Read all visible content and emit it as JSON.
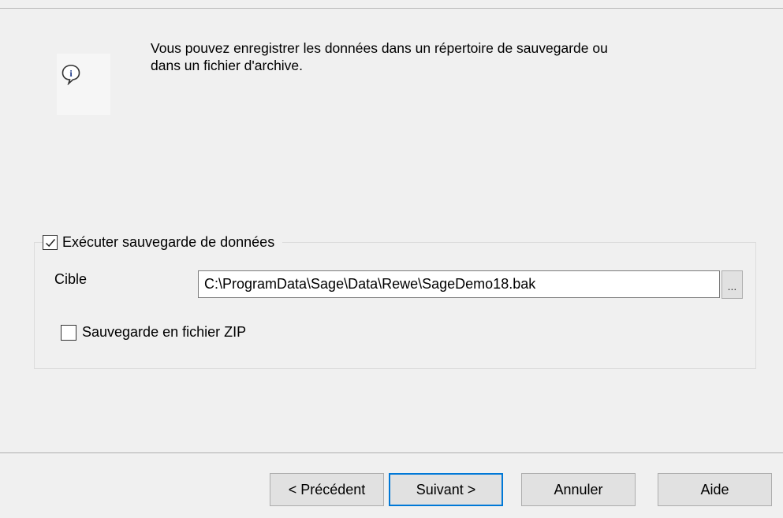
{
  "info": {
    "icon": "info-speech-icon",
    "message": "Vous pouvez enregistrer les données dans un répertoire de sauvegarde ou\ndans un fichier d'archive."
  },
  "backup_group": {
    "checkbox_label": "Exécuter sauvegarde de données",
    "checked": true
  },
  "target": {
    "label": "Cible",
    "value": "C:\\ProgramData\\Sage\\Data\\Rewe\\SageDemo18.bak",
    "browse_label": "..."
  },
  "zip": {
    "label": "Sauvegarde en fichier ZIP",
    "checked": false
  },
  "buttons": {
    "previous": "< Précédent",
    "next": "Suivant >",
    "cancel": "Annuler",
    "help": "Aide"
  },
  "colors": {
    "dialog_bg": "#f0f0f0",
    "focus_border": "#0078d7"
  }
}
